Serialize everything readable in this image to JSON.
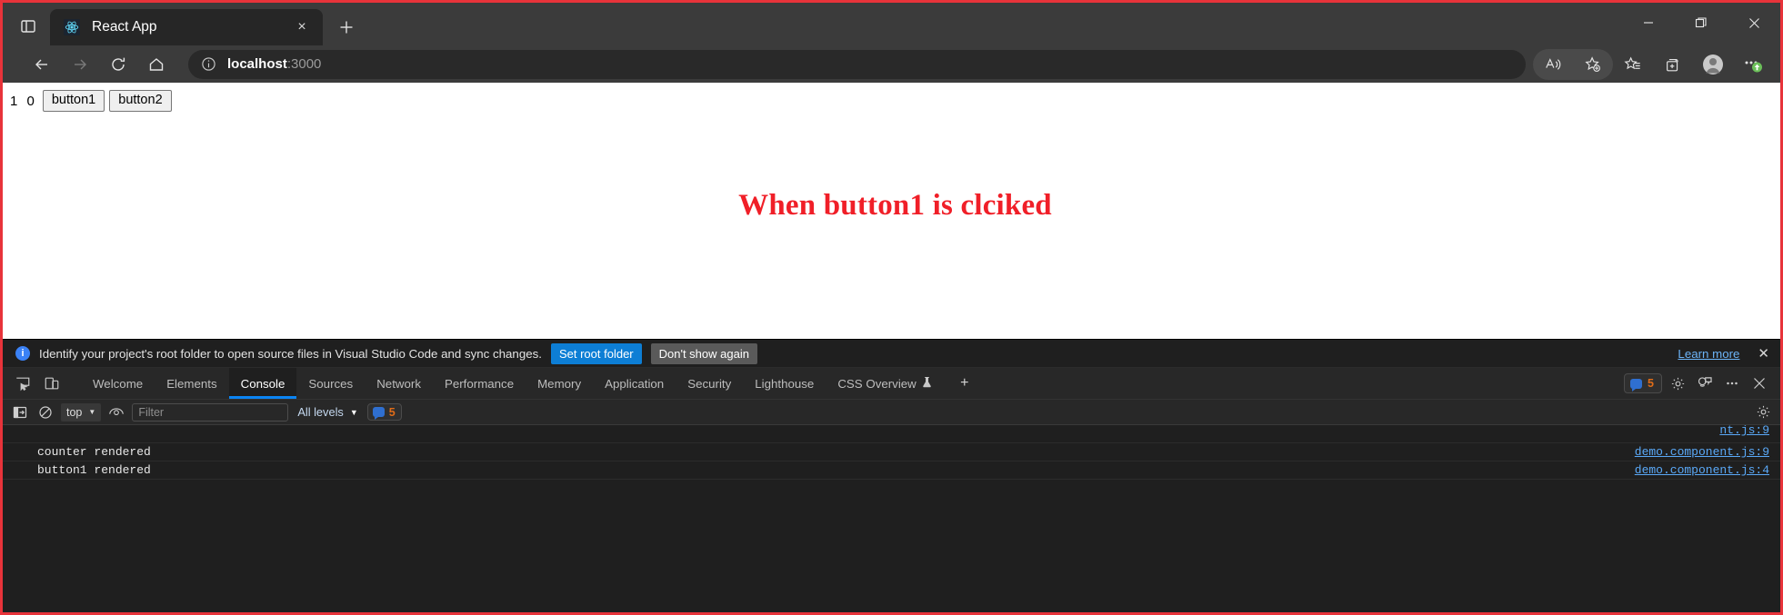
{
  "browser": {
    "tab": {
      "title": "React App",
      "favicon": "react-atom-icon",
      "close": "×"
    },
    "tab_search_icon": "tab-search-icon",
    "new_tab_icon": "+",
    "window_controls": {
      "minimize": "—",
      "restore": "restore-icon",
      "close": "✕"
    },
    "nav": {
      "back": "back-arrow-icon",
      "forward": "forward-arrow-icon",
      "reload": "reload-icon",
      "home": "home-icon"
    },
    "omnibox": {
      "info_icon": "info-circle-icon",
      "url_host": "localhost",
      "url_port": ":3000",
      "url_full": "localhost:3000"
    },
    "toolbar_right": [
      {
        "name": "read-aloud-icon"
      },
      {
        "name": "add-favorite-icon"
      },
      {
        "name": "favorites-icon"
      },
      {
        "name": "collections-icon"
      },
      {
        "name": "profile-avatar"
      },
      {
        "name": "settings-more-icon"
      }
    ]
  },
  "page": {
    "counter_value": "1 0",
    "buttons": [
      {
        "label": "button1"
      },
      {
        "label": "button2"
      }
    ],
    "heading": "When button1 is clciked",
    "heading_color": "#f01f28"
  },
  "devtools": {
    "infobar": {
      "icon": "info-icon",
      "message": "Identify your project's root folder to open source files in Visual Studio Code and sync changes.",
      "primary_button": "Set root folder",
      "secondary_button": "Don't show again",
      "learn_more": "Learn more",
      "close": "✕",
      "primary_color": "#0d7ed5"
    },
    "panel_icons": [
      {
        "name": "inspect-element-icon"
      },
      {
        "name": "device-toolbar-icon"
      }
    ],
    "tabs": [
      {
        "label": "Welcome",
        "active": false
      },
      {
        "label": "Elements",
        "active": false
      },
      {
        "label": "Console",
        "active": true
      },
      {
        "label": "Sources",
        "active": false
      },
      {
        "label": "Network",
        "active": false
      },
      {
        "label": "Performance",
        "active": false
      },
      {
        "label": "Memory",
        "active": false
      },
      {
        "label": "Application",
        "active": false
      },
      {
        "label": "Security",
        "active": false
      },
      {
        "label": "Lighthouse",
        "active": false
      },
      {
        "label": "CSS Overview",
        "active": false,
        "experimental_icon": "flask-icon"
      }
    ],
    "add_tab": "+",
    "message_count": "5",
    "tabbar_right_icons": [
      {
        "name": "settings-gear-icon"
      },
      {
        "name": "feedback-icon"
      },
      {
        "name": "more-options-icon"
      },
      {
        "name": "close-devtools-icon"
      }
    ],
    "console_toolbar": {
      "sidebar_toggle_icon": "console-sidebar-icon",
      "clear_icon": "clear-console-icon",
      "context_selected": "top",
      "eye_icon": "live-expression-eye-icon",
      "filter_placeholder": "Filter",
      "filter_value": "",
      "levels_selected": "All levels",
      "message_count": "5",
      "settings_icon": "console-settings-gear-icon"
    },
    "console_logs": [
      {
        "text": "",
        "source": "nt.js:9",
        "partial": true
      },
      {
        "text": "counter rendered",
        "source": "demo.component.js:9",
        "partial": false
      },
      {
        "text": "button1 rendered",
        "source": "demo.component.js:4",
        "partial": false
      }
    ]
  }
}
